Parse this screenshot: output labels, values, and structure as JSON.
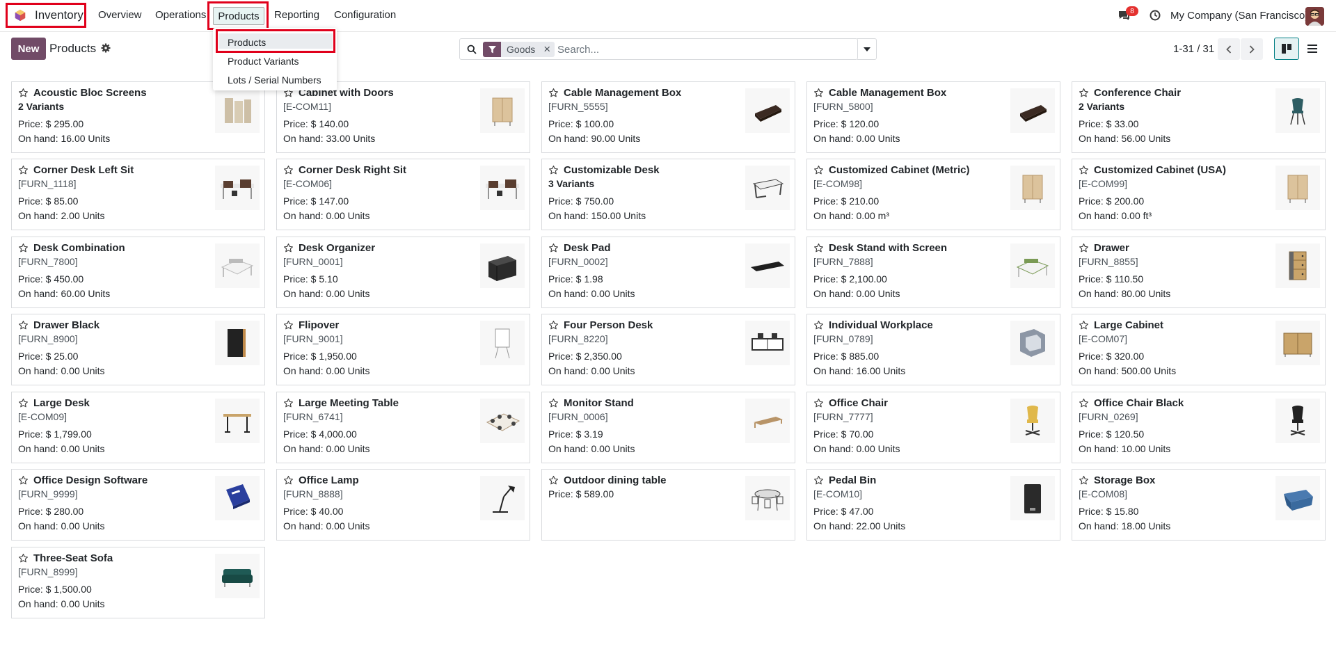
{
  "navbar": {
    "app_name": "Inventory",
    "menus": [
      "Overview",
      "Operations",
      "Products",
      "Reporting",
      "Configuration"
    ],
    "chat_badge": "8",
    "company": "My Company (San Francisco)"
  },
  "dropdown": {
    "items": [
      "Products",
      "Product Variants",
      "Lots / Serial Numbers"
    ]
  },
  "control": {
    "new_label": "New",
    "title": "Products",
    "facet": "Goods",
    "search_placeholder": "Search...",
    "pager": "1-31 / 31"
  },
  "products": [
    {
      "name": "Acoustic Bloc Screens",
      "ref": "2 Variants",
      "variants": true,
      "price": "Price: $ 295.00",
      "onhand": "On hand: 16.00 Units",
      "icon": "screen-panel-icon",
      "color": "#cdbfa6"
    },
    {
      "name": "Cabinet with Doors",
      "ref": "[E-COM11]",
      "variants": false,
      "price": "Price: $ 140.00",
      "onhand": "On hand: 33.00 Units",
      "icon": "cabinet-icon",
      "color": "#dcc39c"
    },
    {
      "name": "Cable Management Box",
      "ref": "[FURN_5555]",
      "variants": false,
      "price": "Price: $ 100.00",
      "onhand": "On hand: 90.00 Units",
      "icon": "cable-box-icon",
      "color": "#3b2a22"
    },
    {
      "name": "Cable Management Box",
      "ref": "[FURN_5800]",
      "variants": false,
      "price": "Price: $ 120.00",
      "onhand": "On hand: 0.00 Units",
      "icon": "cable-box-icon",
      "color": "#3b2a22"
    },
    {
      "name": "Conference Chair",
      "ref": "2 Variants",
      "variants": true,
      "price": "Price: $ 33.00",
      "onhand": "On hand: 56.00 Units",
      "icon": "chair-icon",
      "color": "#2e5d63"
    },
    {
      "name": "Corner Desk Left Sit",
      "ref": "[FURN_1118]",
      "variants": false,
      "price": "Price: $ 85.00",
      "onhand": "On hand: 2.00 Units",
      "icon": "desk-scene-icon",
      "color": "#5a3e30"
    },
    {
      "name": "Corner Desk Right Sit",
      "ref": "[E-COM06]",
      "variants": false,
      "price": "Price: $ 147.00",
      "onhand": "On hand: 0.00 Units",
      "icon": "desk-scene-icon",
      "color": "#5a3e30"
    },
    {
      "name": "Customizable Desk",
      "ref": "3 Variants",
      "variants": true,
      "price": "Price: $ 750.00",
      "onhand": "On hand: 150.00 Units",
      "icon": "desk-icon",
      "color": "#444444"
    },
    {
      "name": "Customized Cabinet (Metric)",
      "ref": "[E-COM98]",
      "variants": false,
      "price": "Price: $ 210.00",
      "onhand": "On hand: 0.00 m³",
      "icon": "cabinet-icon",
      "color": "#dcc39c"
    },
    {
      "name": "Customized Cabinet (USA)",
      "ref": "[E-COM99]",
      "variants": false,
      "price": "Price: $ 200.00",
      "onhand": "On hand: 0.00 ft³",
      "icon": "cabinet-icon",
      "color": "#dcc39c"
    },
    {
      "name": "Desk Combination",
      "ref": "[FURN_7800]",
      "variants": false,
      "price": "Price: $ 450.00",
      "onhand": "On hand: 60.00 Units",
      "icon": "desk-combo-icon",
      "color": "#bbbbbb"
    },
    {
      "name": "Desk Organizer",
      "ref": "[FURN_0001]",
      "variants": false,
      "price": "Price: $ 5.10",
      "onhand": "On hand: 0.00 Units",
      "icon": "organizer-icon",
      "color": "#2b2b2b"
    },
    {
      "name": "Desk Pad",
      "ref": "[FURN_0002]",
      "variants": false,
      "price": "Price: $ 1.98",
      "onhand": "On hand: 0.00 Units",
      "icon": "desk-pad-icon",
      "color": "#1f1f1f"
    },
    {
      "name": "Desk Stand with Screen",
      "ref": "[FURN_7888]",
      "variants": false,
      "price": "Price: $ 2,100.00",
      "onhand": "On hand: 0.00 Units",
      "icon": "desk-combo-icon",
      "color": "#7a9a55"
    },
    {
      "name": "Drawer",
      "ref": "[FURN_8855]",
      "variants": false,
      "price": "Price: $ 110.50",
      "onhand": "On hand: 80.00 Units",
      "icon": "drawer-icon",
      "color": "#c9a46a"
    },
    {
      "name": "Drawer Black",
      "ref": "[FURN_8900]",
      "variants": false,
      "price": "Price: $ 25.00",
      "onhand": "On hand: 0.00 Units",
      "icon": "drawer-black-icon",
      "color": "#222222"
    },
    {
      "name": "Flipover",
      "ref": "[FURN_9001]",
      "variants": false,
      "price": "Price: $ 1,950.00",
      "onhand": "On hand: 0.00 Units",
      "icon": "flipover-icon",
      "color": "#999999"
    },
    {
      "name": "Four Person Desk",
      "ref": "[FURN_8220]",
      "variants": false,
      "price": "Price: $ 2,350.00",
      "onhand": "On hand: 0.00 Units",
      "icon": "four-desk-icon",
      "color": "#333333"
    },
    {
      "name": "Individual Workplace",
      "ref": "[FURN_0789]",
      "variants": false,
      "price": "Price: $ 885.00",
      "onhand": "On hand: 16.00 Units",
      "icon": "workplace-icon",
      "color": "#8c96a5"
    },
    {
      "name": "Large Cabinet",
      "ref": "[E-COM07]",
      "variants": false,
      "price": "Price: $ 320.00",
      "onhand": "On hand: 500.00 Units",
      "icon": "large-cabinet-icon",
      "color": "#c9a46a"
    },
    {
      "name": "Large Desk",
      "ref": "[E-COM09]",
      "variants": false,
      "price": "Price: $ 1,799.00",
      "onhand": "On hand: 0.00 Units",
      "icon": "large-desk-icon",
      "color": "#222222"
    },
    {
      "name": "Large Meeting Table",
      "ref": "[FURN_6741]",
      "variants": false,
      "price": "Price: $ 4,000.00",
      "onhand": "On hand: 0.00 Units",
      "icon": "meeting-table-icon",
      "color": "#b09a7e"
    },
    {
      "name": "Monitor Stand",
      "ref": "[FURN_0006]",
      "variants": false,
      "price": "Price: $ 3.19",
      "onhand": "On hand: 0.00 Units",
      "icon": "monitor-stand-icon",
      "color": "#b89468"
    },
    {
      "name": "Office Chair",
      "ref": "[FURN_7777]",
      "variants": false,
      "price": "Price: $ 70.00",
      "onhand": "On hand: 0.00 Units",
      "icon": "office-chair-icon",
      "color": "#e0b84b"
    },
    {
      "name": "Office Chair Black",
      "ref": "[FURN_0269]",
      "variants": false,
      "price": "Price: $ 120.50",
      "onhand": "On hand: 10.00 Units",
      "icon": "office-chair-icon",
      "color": "#222222"
    },
    {
      "name": "Office Design Software",
      "ref": "[FURN_9999]",
      "variants": false,
      "price": "Price: $ 280.00",
      "onhand": "On hand: 0.00 Units",
      "icon": "software-box-icon",
      "color": "#2a3f9e"
    },
    {
      "name": "Office Lamp",
      "ref": "[FURN_8888]",
      "variants": false,
      "price": "Price: $ 40.00",
      "onhand": "On hand: 0.00 Units",
      "icon": "lamp-icon",
      "color": "#222222"
    },
    {
      "name": "Outdoor dining table",
      "ref": "",
      "variants": false,
      "price": "Price: $ 589.00",
      "onhand": "",
      "icon": "dining-table-icon",
      "color": "#444444"
    },
    {
      "name": "Pedal Bin",
      "ref": "[E-COM10]",
      "variants": false,
      "price": "Price: $ 47.00",
      "onhand": "On hand: 22.00 Units",
      "icon": "bin-icon",
      "color": "#2a2a2a"
    },
    {
      "name": "Storage Box",
      "ref": "[E-COM08]",
      "variants": false,
      "price": "Price: $ 15.80",
      "onhand": "On hand: 18.00 Units",
      "icon": "storage-box-icon",
      "color": "#2e5a8a"
    },
    {
      "name": "Three-Seat Sofa",
      "ref": "[FURN_8999]",
      "variants": false,
      "price": "Price: $ 1,500.00",
      "onhand": "On hand: 0.00 Units",
      "icon": "sofa-icon",
      "color": "#1f5a55"
    }
  ],
  "colors": {
    "brand": "#714b67",
    "accent": "#017e84",
    "highlight": "#e0001b"
  }
}
